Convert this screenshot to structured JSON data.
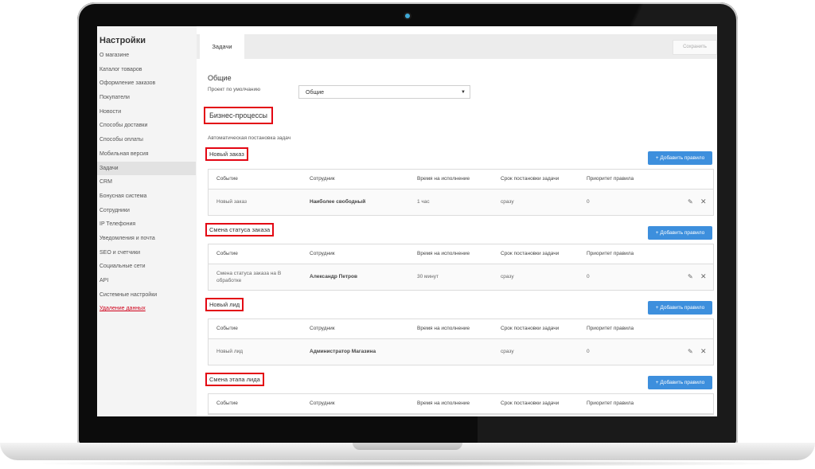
{
  "sidebar": {
    "title": "Настройки",
    "items": [
      {
        "label": "О магазине"
      },
      {
        "label": "Каталог товаров"
      },
      {
        "label": "Оформление заказов"
      },
      {
        "label": "Покупатели"
      },
      {
        "label": "Новости"
      },
      {
        "label": "Способы доставки"
      },
      {
        "label": "Способы оплаты"
      },
      {
        "label": "Мобильная версия"
      },
      {
        "label": "Задачи",
        "active": true
      },
      {
        "label": "CRM"
      },
      {
        "label": "Бонусная система"
      },
      {
        "label": "Сотрудники"
      },
      {
        "label": "IP Телефония"
      },
      {
        "label": "Уведомления и почта"
      },
      {
        "label": "SEO и счетчики"
      },
      {
        "label": "Социальные сети"
      },
      {
        "label": "API"
      },
      {
        "label": "Системные настройки"
      },
      {
        "label": "Удаление данных",
        "danger": true
      }
    ]
  },
  "header": {
    "tab_label": "Задачи",
    "save_label": "Сохранить"
  },
  "general": {
    "title": "Общие",
    "default_project_label": "Проект по умолчанию",
    "default_project_value": "Общие"
  },
  "business": {
    "title": "Бизнес-процессы",
    "auto_label": "Автоматическая постановка задач"
  },
  "add_rule_label": "+ Добавить правило",
  "columns": {
    "event": "Событие",
    "employee": "Сотрудник",
    "time": "Время на исполнение",
    "deadline": "Срок постановки задачи",
    "priority": "Приоритет правила"
  },
  "groups": [
    {
      "title": "Новый заказ",
      "row": {
        "event": "Новый заказ",
        "employee": "Наиболее свободный",
        "time": "1 час",
        "deadline": "сразу",
        "priority": "0"
      }
    },
    {
      "title": "Смена статуса заказа",
      "row": {
        "event": "Смена статуса заказа на В обработке",
        "employee": "Александр Петров",
        "time": "30 минут",
        "deadline": "сразу",
        "priority": "0"
      }
    },
    {
      "title": "Новый лид",
      "row": {
        "event": "Новый лид",
        "employee": "Администратор Магазина",
        "time": "",
        "deadline": "сразу",
        "priority": "0"
      }
    },
    {
      "title": "Смена этапа лида"
    }
  ],
  "icons": {
    "edit": "pencil-icon",
    "delete": "close-icon",
    "caret": "caret-down-icon"
  },
  "colors": {
    "accent": "#3d8fdd",
    "highlight": "#e30613",
    "danger_link": "#d0021b"
  }
}
